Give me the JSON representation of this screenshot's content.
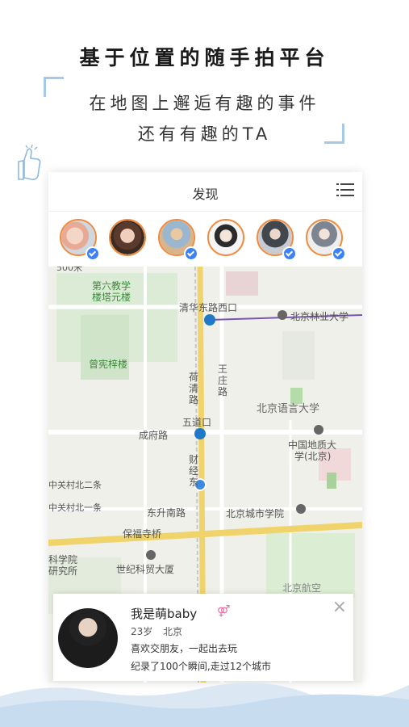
{
  "promo": {
    "headline": "基于位置的随手拍平台",
    "sub1": "在地图上邂逅有趣的事件",
    "sub2": "还有有趣的TA"
  },
  "app": {
    "title": "发现",
    "menu_icon": "list-icon",
    "avatars": [
      {
        "verified": true,
        "tone": "#e5b9a0"
      },
      {
        "verified": false,
        "tone": "#8c6c5a"
      },
      {
        "verified": true,
        "tone": "#c9a87a"
      },
      {
        "verified": false,
        "tone": "#f2f2f2"
      },
      {
        "verified": true,
        "tone": "#6a6f78"
      },
      {
        "verified": true,
        "tone": "#e8e8e8"
      }
    ]
  },
  "map": {
    "scale": "500米",
    "labels": {
      "a": "第六教学",
      "a2": "楼塔元楼",
      "b": "清华东路西口",
      "c": "北京林业大学",
      "d": "曾宪梓楼",
      "e": "荷",
      "e2": "清",
      "e3": "路",
      "f": "王",
      "f2": "庄",
      "f3": "路",
      "g": "北京语言大学",
      "h": "五道口",
      "i": "成府路",
      "j": "中国地质大",
      "j2": "学(北京)",
      "k": "财",
      "k2": "经",
      "k3": "东",
      "l": "中关村北二条",
      "m": "中关村北一条",
      "n": "东升南路",
      "o": "北京城市学院",
      "p": "保福寺桥",
      "q": "科学院",
      "q2": "研究所",
      "r": "世纪科贸大厦",
      "s": "北京航空"
    }
  },
  "profile": {
    "name": "我是萌baby",
    "gender_symbol": "⚤",
    "age": "23岁",
    "city": "北京",
    "bio": "喜欢交朋友，一起出去玩",
    "stats": "纪录了100个瞬间,走过12个城市",
    "close": "×"
  }
}
